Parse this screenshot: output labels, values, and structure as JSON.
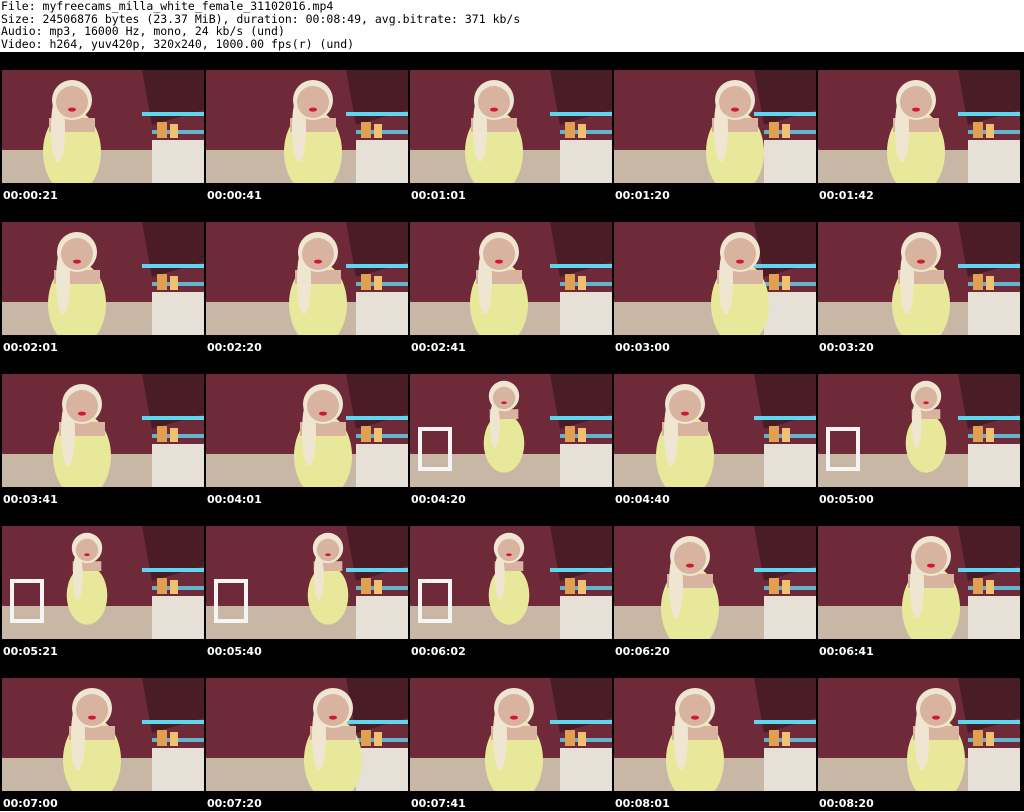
{
  "header": {
    "file_line": "File: myfreecams_milla_white_female_31102016.mp4",
    "size_line": "Size: 24506876 bytes (23.37 MiB), duration: 00:08:49, avg.bitrate: 371 kb/s",
    "audio_line": "Audio: mp3, 16000 Hz, mono, 24 kb/s (und)",
    "video_line": "Video: h264, yuv420p, 320x240, 1000.00 fps(r) (und)"
  },
  "colors": {
    "sheet_background": "#000000",
    "header_background": "#ffffff",
    "wall": "#6e2a38",
    "floor": "#c8b7a5",
    "cabinet": "#e6e0d6",
    "dress": "#e8e89a",
    "skin": "#d8b4a0",
    "hair": "#efe6d2",
    "light_strip": "#5fd6f0",
    "timestamp_text": "#ffffff"
  },
  "thumbnails": [
    {
      "time": "00:00:21"
    },
    {
      "time": "00:00:41"
    },
    {
      "time": "00:01:01"
    },
    {
      "time": "00:01:20"
    },
    {
      "time": "00:01:42"
    },
    {
      "time": "00:02:01"
    },
    {
      "time": "00:02:20"
    },
    {
      "time": "00:02:41"
    },
    {
      "time": "00:03:00"
    },
    {
      "time": "00:03:20"
    },
    {
      "time": "00:03:41"
    },
    {
      "time": "00:04:01"
    },
    {
      "time": "00:04:20"
    },
    {
      "time": "00:04:40"
    },
    {
      "time": "00:05:00"
    },
    {
      "time": "00:05:21"
    },
    {
      "time": "00:05:40"
    },
    {
      "time": "00:06:02"
    },
    {
      "time": "00:06:20"
    },
    {
      "time": "00:06:41"
    },
    {
      "time": "00:07:00"
    },
    {
      "time": "00:07:20"
    },
    {
      "time": "00:07:41"
    },
    {
      "time": "00:08:01"
    },
    {
      "time": "00:08:20"
    }
  ]
}
